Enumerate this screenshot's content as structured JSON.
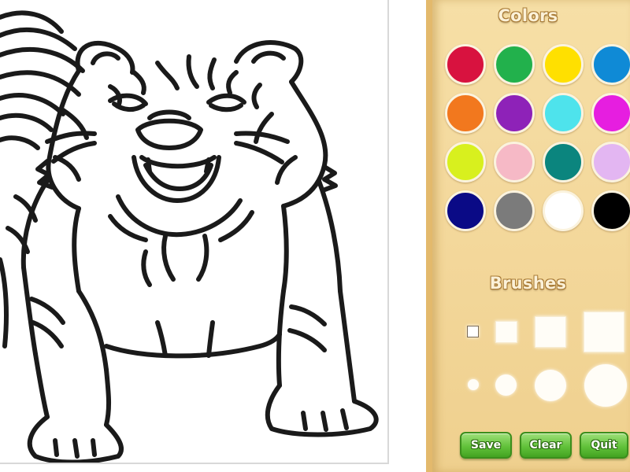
{
  "palette": {
    "colors_title": "Colors",
    "brushes_title": "Brushes",
    "swatches": [
      {
        "name": "red",
        "color": "#d8123f"
      },
      {
        "name": "green",
        "color": "#22b14c"
      },
      {
        "name": "yellow",
        "color": "#ffe000"
      },
      {
        "name": "blue",
        "color": "#0f8ad6"
      },
      {
        "name": "orange",
        "color": "#f2781e"
      },
      {
        "name": "purple",
        "color": "#8e22b8"
      },
      {
        "name": "cyan",
        "color": "#4ee3ec"
      },
      {
        "name": "magenta",
        "color": "#e61ee0"
      },
      {
        "name": "lime",
        "color": "#d8f01e"
      },
      {
        "name": "pink",
        "color": "#f6b9c6"
      },
      {
        "name": "teal",
        "color": "#0b857e"
      },
      {
        "name": "lavender",
        "color": "#e3b6f2"
      },
      {
        "name": "navy",
        "color": "#0a0a86"
      },
      {
        "name": "gray",
        "color": "#7b7b7b"
      },
      {
        "name": "white",
        "color": "#ffffff"
      },
      {
        "name": "black",
        "color": "#000000"
      }
    ],
    "brush_shapes": [
      "square",
      "round"
    ],
    "brush_sizes": [
      "tiny",
      "small",
      "medium",
      "large"
    ]
  },
  "buttons": {
    "save": "Save",
    "clear": "Clear",
    "quit": "Quit"
  },
  "canvas": {
    "picture": "tiger"
  }
}
